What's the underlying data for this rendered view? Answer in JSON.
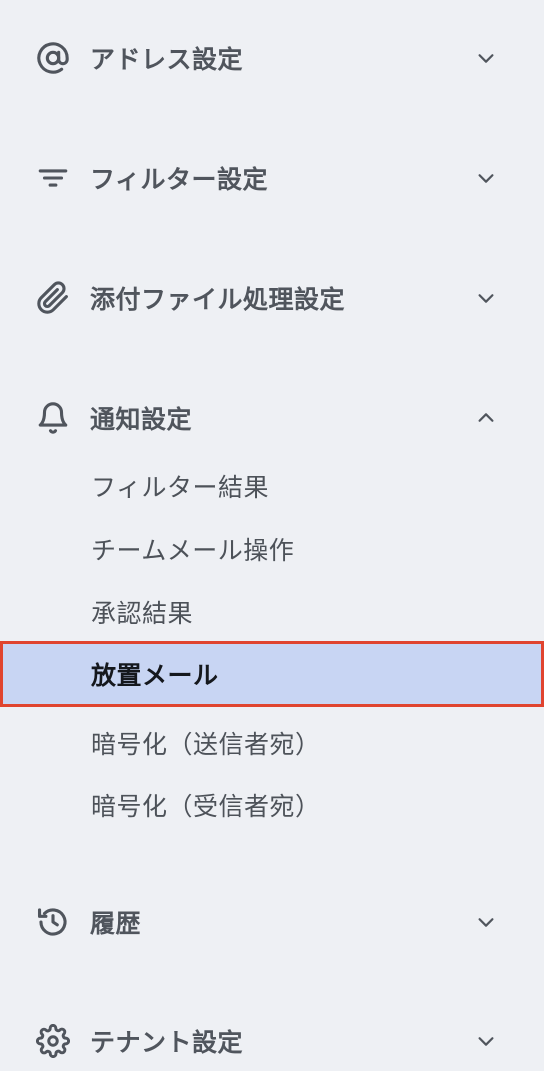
{
  "sections": [
    {
      "label": "アドレス設定",
      "icon": "at-sign-icon",
      "chevron": "down"
    },
    {
      "label": "フィルター設定",
      "icon": "filter-icon",
      "chevron": "down"
    },
    {
      "label": "添付ファイル処理設定",
      "icon": "paperclip-icon",
      "chevron": "down"
    },
    {
      "label": "通知設定",
      "icon": "bell-icon",
      "chevron": "up"
    },
    {
      "label": "履歴",
      "icon": "history-icon",
      "chevron": "down"
    },
    {
      "label": "テナント設定",
      "icon": "gear-icon",
      "chevron": "down"
    }
  ],
  "notification_items": [
    {
      "label": "フィルター結果"
    },
    {
      "label": "チームメール操作"
    },
    {
      "label": "承認結果"
    },
    {
      "label": "放置メール",
      "selected": true
    },
    {
      "label": "暗号化（送信者宛）"
    },
    {
      "label": "暗号化（受信者宛）"
    }
  ],
  "colors": {
    "background": "#eef0f4",
    "selected_background": "#c8d5f3",
    "selected_border": "#e0442f",
    "text": "#50555d"
  }
}
